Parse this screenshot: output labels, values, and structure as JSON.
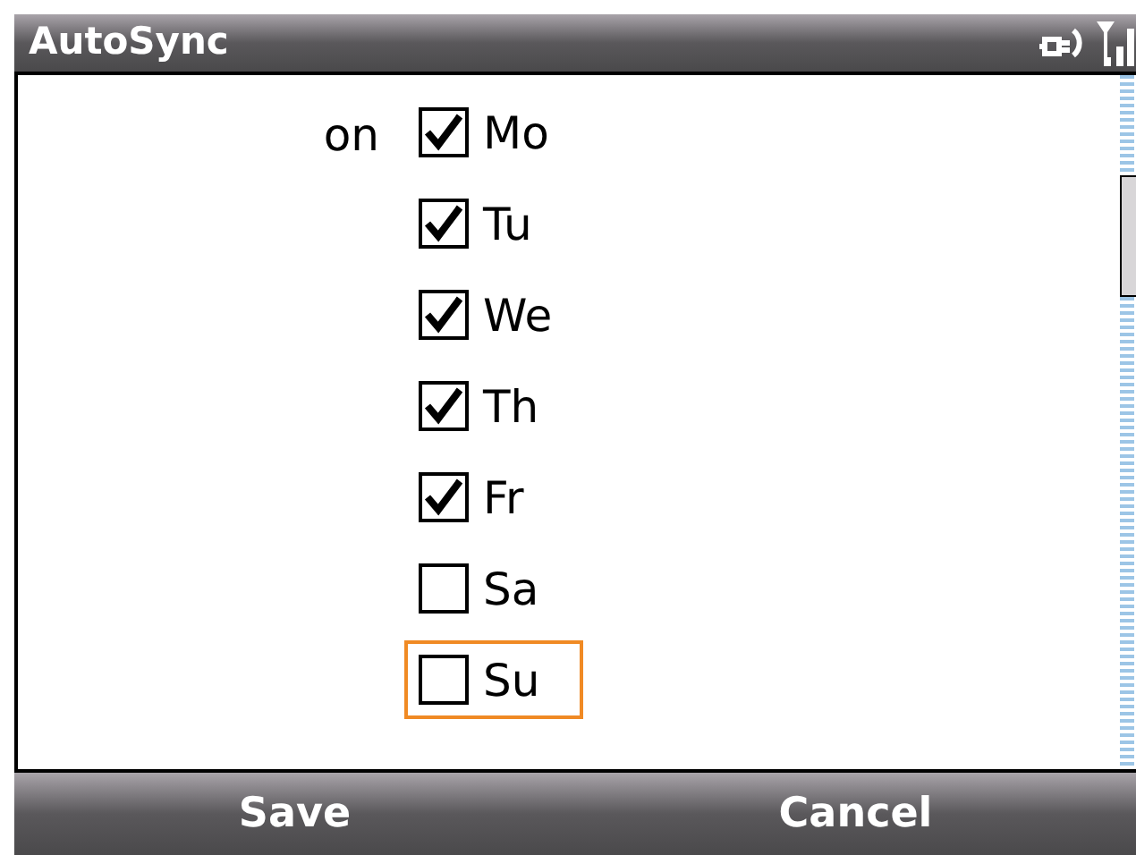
{
  "title_bar": {
    "title": "AutoSync"
  },
  "schedule": {
    "label": "on",
    "days": [
      {
        "label": "Mo",
        "checked": true,
        "selected": false
      },
      {
        "label": "Tu",
        "checked": true,
        "selected": false
      },
      {
        "label": "We",
        "checked": true,
        "selected": false
      },
      {
        "label": "Th",
        "checked": true,
        "selected": false
      },
      {
        "label": "Fr",
        "checked": true,
        "selected": false
      },
      {
        "label": "Sa",
        "checked": false,
        "selected": false
      },
      {
        "label": "Su",
        "checked": false,
        "selected": true
      }
    ]
  },
  "softkeys": [
    "Save",
    "Cancel"
  ]
}
